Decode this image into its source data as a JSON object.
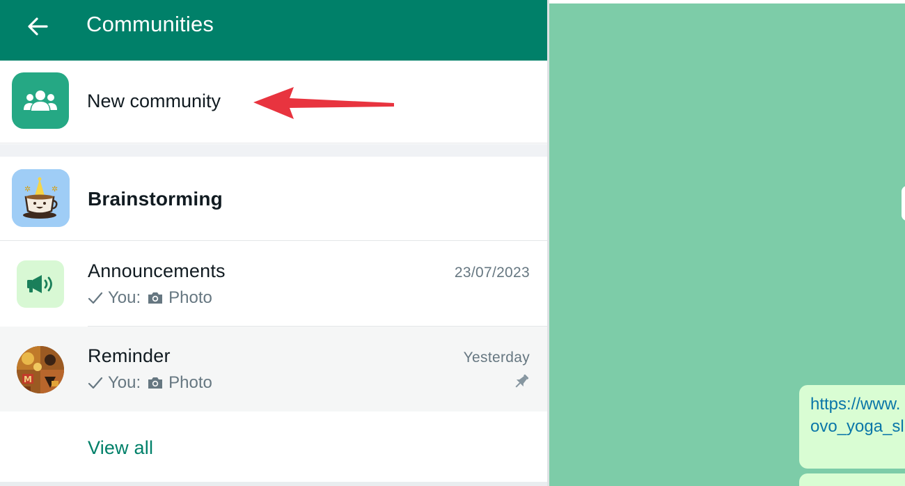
{
  "header": {
    "title": "Communities",
    "back_icon": "arrow-left-icon",
    "background": "#008069"
  },
  "new_community": {
    "label": "New community",
    "icon": "people-group-icon",
    "icon_background": "#25a884"
  },
  "community": {
    "name": "Brainstorming"
  },
  "chats": [
    {
      "name": "Announcements",
      "time": "23/07/2023",
      "sender": "You:",
      "preview": "Photo",
      "icon": "megaphone-icon",
      "pinned": false
    },
    {
      "name": "Reminder",
      "time": "Yesterday",
      "sender": "You:",
      "preview": "Photo",
      "icon": "pin-icon",
      "pinned": true
    }
  ],
  "view_all": "View all",
  "conversation": {
    "link_line_1": "https://www.",
    "link_line_2": "ovo_yoga_sl",
    "wallpaper": "#7dcca8",
    "bubble_color": "#d9fdd3"
  },
  "colors": {
    "accent": "#008069",
    "annotation_arrow": "#e8343f"
  }
}
